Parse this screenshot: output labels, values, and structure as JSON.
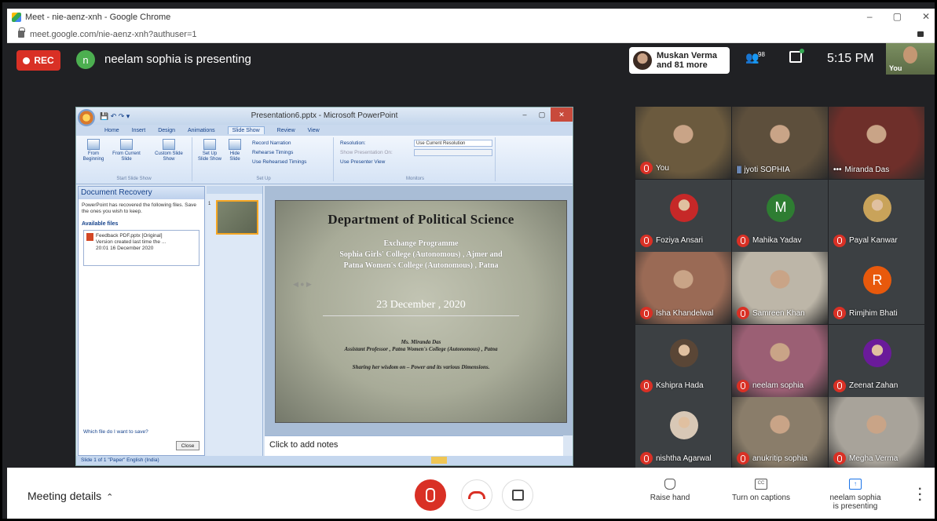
{
  "browser": {
    "window_title": "Meet - nie-aenz-xnh - Google Chrome",
    "url": "meet.google.com/nie-aenz-xnh?authuser=1",
    "controls": [
      "–",
      "▢",
      "✕"
    ]
  },
  "meet_top": {
    "rec_label": "REC",
    "presenter_initial": "n",
    "presenting_text": "neelam sophia is presenting",
    "viewers_line1": "Muskan Verma",
    "viewers_line2": "and 81 more",
    "people_count": "98",
    "time": "5:15 PM",
    "self_label": "You"
  },
  "powerpoint": {
    "title": "Presentation6.pptx - Microsoft PowerPoint",
    "tabs": [
      "Home",
      "Insert",
      "Design",
      "Animations",
      "Slide Show",
      "Review",
      "View"
    ],
    "active_tab": "Slide Show",
    "ribbon": {
      "from_beginning": "From Beginning",
      "from_current": "From Current Slide",
      "custom_show": "Custom Slide Show",
      "group_start": "Start Slide Show",
      "setup_show": "Set Up Slide Show",
      "hide_slide": "Hide Slide",
      "record_narration": "Record Narration",
      "rehearse": "Rehearse Timings",
      "use_rehearsed": "Use Rehearsed Timings",
      "group_setup": "Set Up",
      "resolution_label": "Resolution:",
      "resolution_value": "Use Current Resolution",
      "show_on": "Show Presentation On:",
      "presenter_view": "Use Presenter View",
      "group_monitors": "Monitors"
    },
    "recovery": {
      "header": "Document Recovery",
      "message": "PowerPoint has recovered the following files. Save the ones you wish to keep.",
      "available": "Available files",
      "file_name": "Feedback PDF.pptx  [Original]",
      "file_detail": "Version created last time the ...",
      "file_time": "20:01 16 December 2020",
      "which": "Which file do I want to save?",
      "close": "Close"
    },
    "thumb_number": "1",
    "slide": {
      "title": "Department of  Political  Science",
      "sub1": "Exchange Programme",
      "sub2": "Sophia Girls' College (Autonomous) , Ajmer and",
      "sub3": "Patna Women's College (Autonomous) , Patna",
      "date": "23 December , 2020",
      "speaker": "Ms. Miranda Das",
      "designation": "Assistant Professor , Patna Women's College (Autonomous) , Patna",
      "sharing": "Sharing her wisdom on – Power and its various Dimensions."
    },
    "notes_placeholder": "Click to add notes",
    "status": "Slide 1 of 1   \"Paper\"   English (India)"
  },
  "participants": [
    {
      "name": "You",
      "type": "video",
      "color": "#6b5a3e"
    },
    {
      "name": "jyoti SOPHIA",
      "type": "video",
      "color": "#5d4f3c",
      "speaking": true
    },
    {
      "name": "Miranda Das",
      "type": "video",
      "color": "#6e2f2a",
      "more": true
    },
    {
      "name": "Foziya Ansari",
      "type": "photo",
      "color": "#c62828"
    },
    {
      "name": "Mahika Yadav",
      "type": "letter",
      "letter": "M",
      "color": "#2e7d32"
    },
    {
      "name": "Payal Kanwar",
      "type": "photo",
      "color": "#c9a35a"
    },
    {
      "name": "Isha Khandelwal",
      "type": "video",
      "color": "#9a6a55"
    },
    {
      "name": "Samreen Khan",
      "type": "video",
      "color": "#bdb6a8"
    },
    {
      "name": "Rimjhim Bhati",
      "type": "letter",
      "letter": "R",
      "color": "#e8590c"
    },
    {
      "name": "Kshipra Hada",
      "type": "photo",
      "color": "#5a4636"
    },
    {
      "name": "neelam sophia",
      "type": "video",
      "color": "#9b5f74"
    },
    {
      "name": "Zeenat Zahan",
      "type": "photo",
      "color": "#6a1b9a"
    },
    {
      "name": "nishtha Agarwal",
      "type": "photo",
      "color": "#d8c8b6"
    },
    {
      "name": "anukritip sophia",
      "type": "video",
      "color": "#8a7d6a"
    },
    {
      "name": "Megha Verma",
      "type": "video",
      "color": "#a8a39a"
    }
  ],
  "bottom": {
    "meeting_details": "Meeting details",
    "raise_hand": "Raise hand",
    "captions": "Turn on captions",
    "presenting_line1": "neelam sophia",
    "presenting_line2": "is presenting"
  }
}
